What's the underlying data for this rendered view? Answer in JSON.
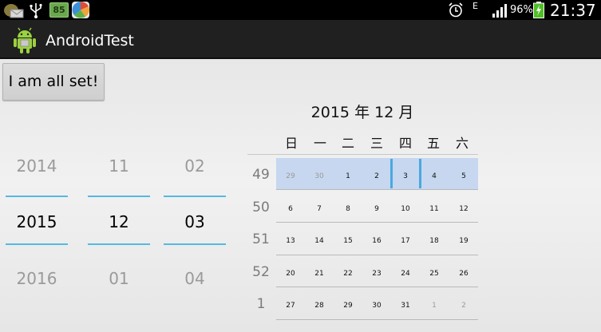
{
  "status_bar": {
    "network_type": "E",
    "battery_percent": "96%",
    "time": "21:37",
    "notification_badge": "85",
    "icons": [
      "email-icon",
      "usb-icon",
      "battery-app-icon",
      "app-icon",
      "alarm-icon",
      "signal-icon",
      "battery-icon"
    ]
  },
  "action_bar": {
    "title": "AndroidTest",
    "icon": "android-icon"
  },
  "button": {
    "label": "I am all set!"
  },
  "date_picker": {
    "year": {
      "prev": "2014",
      "current": "2015",
      "next": "2016"
    },
    "month": {
      "prev": "11",
      "current": "12",
      "next": "01"
    },
    "day": {
      "prev": "02",
      "current": "03",
      "next": "04"
    }
  },
  "calendar": {
    "title": "2015 年 12 月",
    "weekdays": [
      "日",
      "一",
      "二",
      "三",
      "四",
      "五",
      "六"
    ],
    "weeks": [
      {
        "num": "49",
        "days": [
          "29",
          "30",
          "1",
          "2",
          "3",
          "4",
          "5"
        ]
      },
      {
        "num": "50",
        "days": [
          "6",
          "7",
          "8",
          "9",
          "10",
          "11",
          "12"
        ]
      },
      {
        "num": "51",
        "days": [
          "13",
          "14",
          "15",
          "16",
          "17",
          "18",
          "19"
        ]
      },
      {
        "num": "52",
        "days": [
          "20",
          "21",
          "22",
          "23",
          "24",
          "25",
          "26"
        ]
      },
      {
        "num": "1",
        "days": [
          "27",
          "28",
          "29",
          "30",
          "31",
          "1",
          "2"
        ]
      }
    ],
    "selected_date": "3",
    "colors": {
      "selection": "#c6d7ef",
      "accent": "#4aa9df"
    }
  }
}
